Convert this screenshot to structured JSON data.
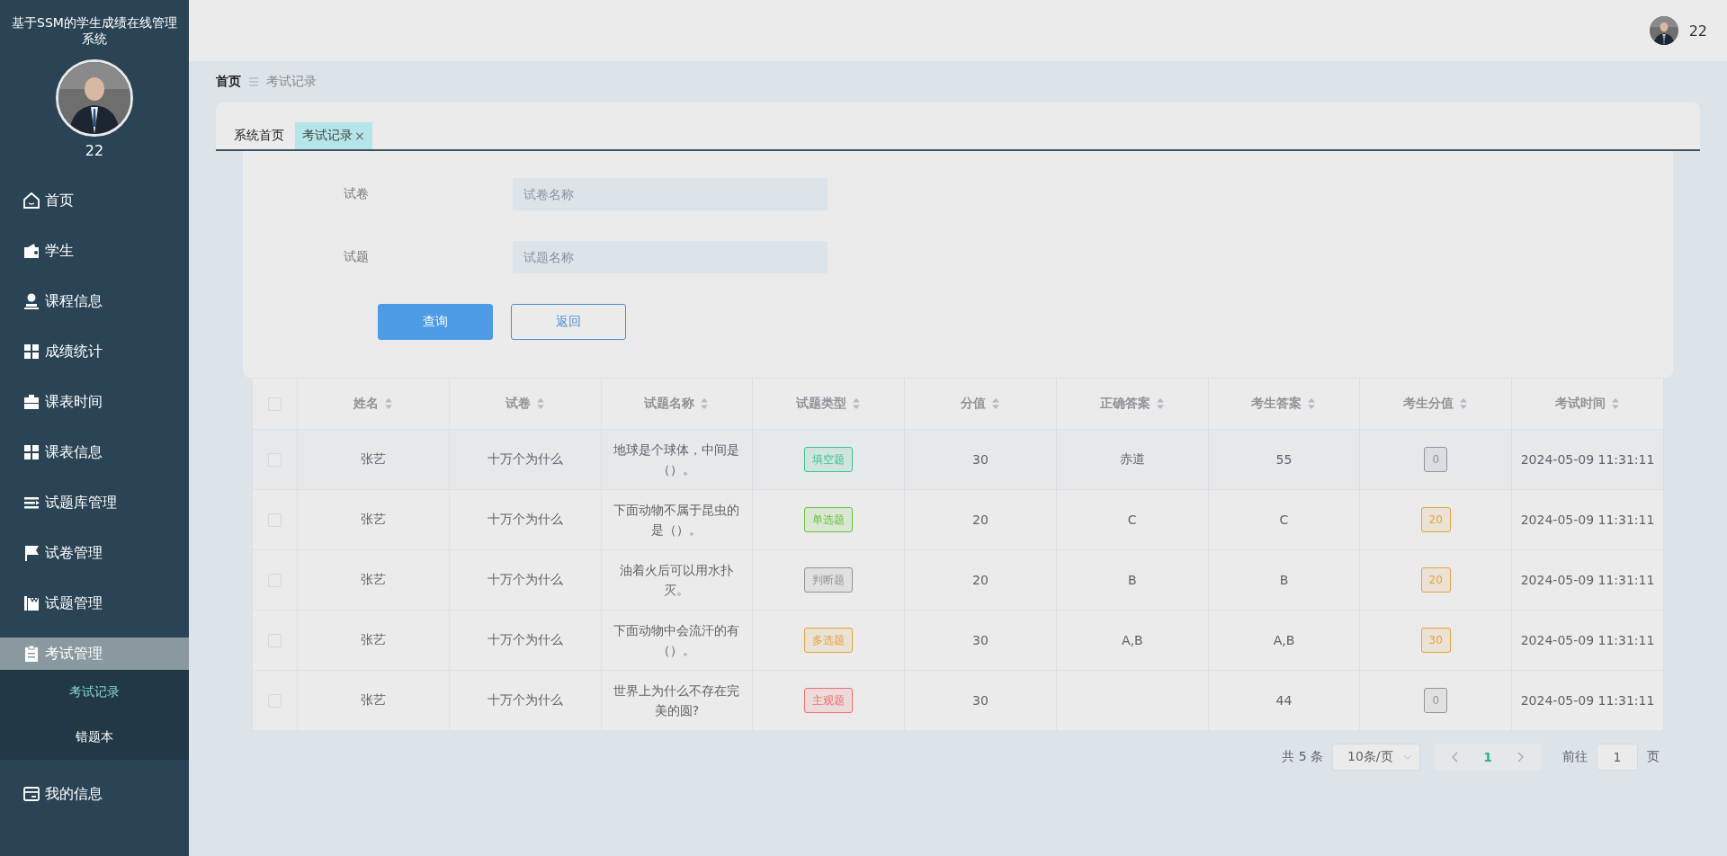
{
  "sidebar": {
    "title": "基于SSM的学生成绩在线管理系统",
    "user_name": "22",
    "items": [
      {
        "label": "首页",
        "selected": false
      },
      {
        "label": "学生",
        "selected": false
      },
      {
        "label": "课程信息",
        "selected": false
      },
      {
        "label": "成绩统计",
        "selected": false
      },
      {
        "label": "课表时间",
        "selected": false
      },
      {
        "label": "课表信息",
        "selected": false
      },
      {
        "label": "试题库管理",
        "selected": false
      },
      {
        "label": "试卷管理",
        "selected": false
      },
      {
        "label": "试题管理",
        "selected": false
      },
      {
        "label": "考试管理",
        "selected": true,
        "expanded": true,
        "children": [
          {
            "label": "考试记录",
            "selected": true
          },
          {
            "label": "错题本",
            "selected": false
          }
        ]
      },
      {
        "label": "我的信息",
        "selected": false
      }
    ]
  },
  "header": {
    "user_name": "22"
  },
  "breadcrumb": [
    "首页",
    "考试记录"
  ],
  "tabs": [
    {
      "label": "系统首页",
      "selected": false
    },
    {
      "label": "考试记录",
      "selected": true,
      "close": "×"
    }
  ],
  "search": {
    "fields": [
      {
        "label": "试卷",
        "placeholder": "试卷名称"
      },
      {
        "label": "试题",
        "placeholder": "试题名称"
      }
    ],
    "buttons": [
      {
        "label": "查询",
        "kind": "primary"
      },
      {
        "label": "返回",
        "kind": "plain"
      }
    ]
  },
  "table": {
    "all_checked": false,
    "columns": [
      "姓名",
      "试卷",
      "试题名称",
      "试题类型",
      "分值",
      "正确答案",
      "考生答案",
      "考生分值",
      "考试时间"
    ],
    "rows": [
      {
        "checked": false,
        "name": "张艺",
        "paper": "十万个为什么",
        "question": "地球是个球体，中间是（）。",
        "type": {
          "label": "填空题",
          "color": "#3cc48a"
        },
        "points": "30",
        "correct": "赤道",
        "answer": "55",
        "score": {
          "label": "0",
          "color": "#909399"
        },
        "time": "2024-05-09 11:31:11"
      },
      {
        "checked": false,
        "name": "张艺",
        "paper": "十万个为什么",
        "question": "下面动物不属于昆虫的是（）。",
        "type": {
          "label": "单选题",
          "color": "#67c23a"
        },
        "points": "20",
        "correct": "C",
        "answer": "C",
        "score": {
          "label": "20",
          "color": "#e6a23c"
        },
        "time": "2024-05-09 11:31:11"
      },
      {
        "checked": false,
        "name": "张艺",
        "paper": "十万个为什么",
        "question": "油着火后可以用水扑灭。",
        "type": {
          "label": "判断题",
          "color": "#909399"
        },
        "points": "20",
        "correct": "B",
        "answer": "B",
        "score": {
          "label": "20",
          "color": "#e6a23c"
        },
        "time": "2024-05-09 11:31:11"
      },
      {
        "checked": false,
        "name": "张艺",
        "paper": "十万个为什么",
        "question": "下面动物中会流汗的有（）。",
        "type": {
          "label": "多选题",
          "color": "#e6a23c"
        },
        "points": "30",
        "correct": "A,B",
        "answer": "A,B",
        "score": {
          "label": "30",
          "color": "#e6a23c"
        },
        "time": "2024-05-09 11:31:11"
      },
      {
        "checked": false,
        "name": "张艺",
        "paper": "十万个为什么",
        "question": "世界上为什么不存在完美的圆?",
        "type": {
          "label": "主观题",
          "color": "#f56c6c"
        },
        "points": "30",
        "answer": "44",
        "score": {
          "label": "0",
          "color": "#909399"
        },
        "time": "2024-05-09 11:31:11"
      }
    ]
  },
  "pagination": {
    "total": "共 5 条",
    "page_size": "10条/页",
    "pages": [
      {
        "label": "1",
        "selected": true
      }
    ],
    "goto_label": "前往",
    "goto_value": "1",
    "goto_suffix": "页"
  }
}
